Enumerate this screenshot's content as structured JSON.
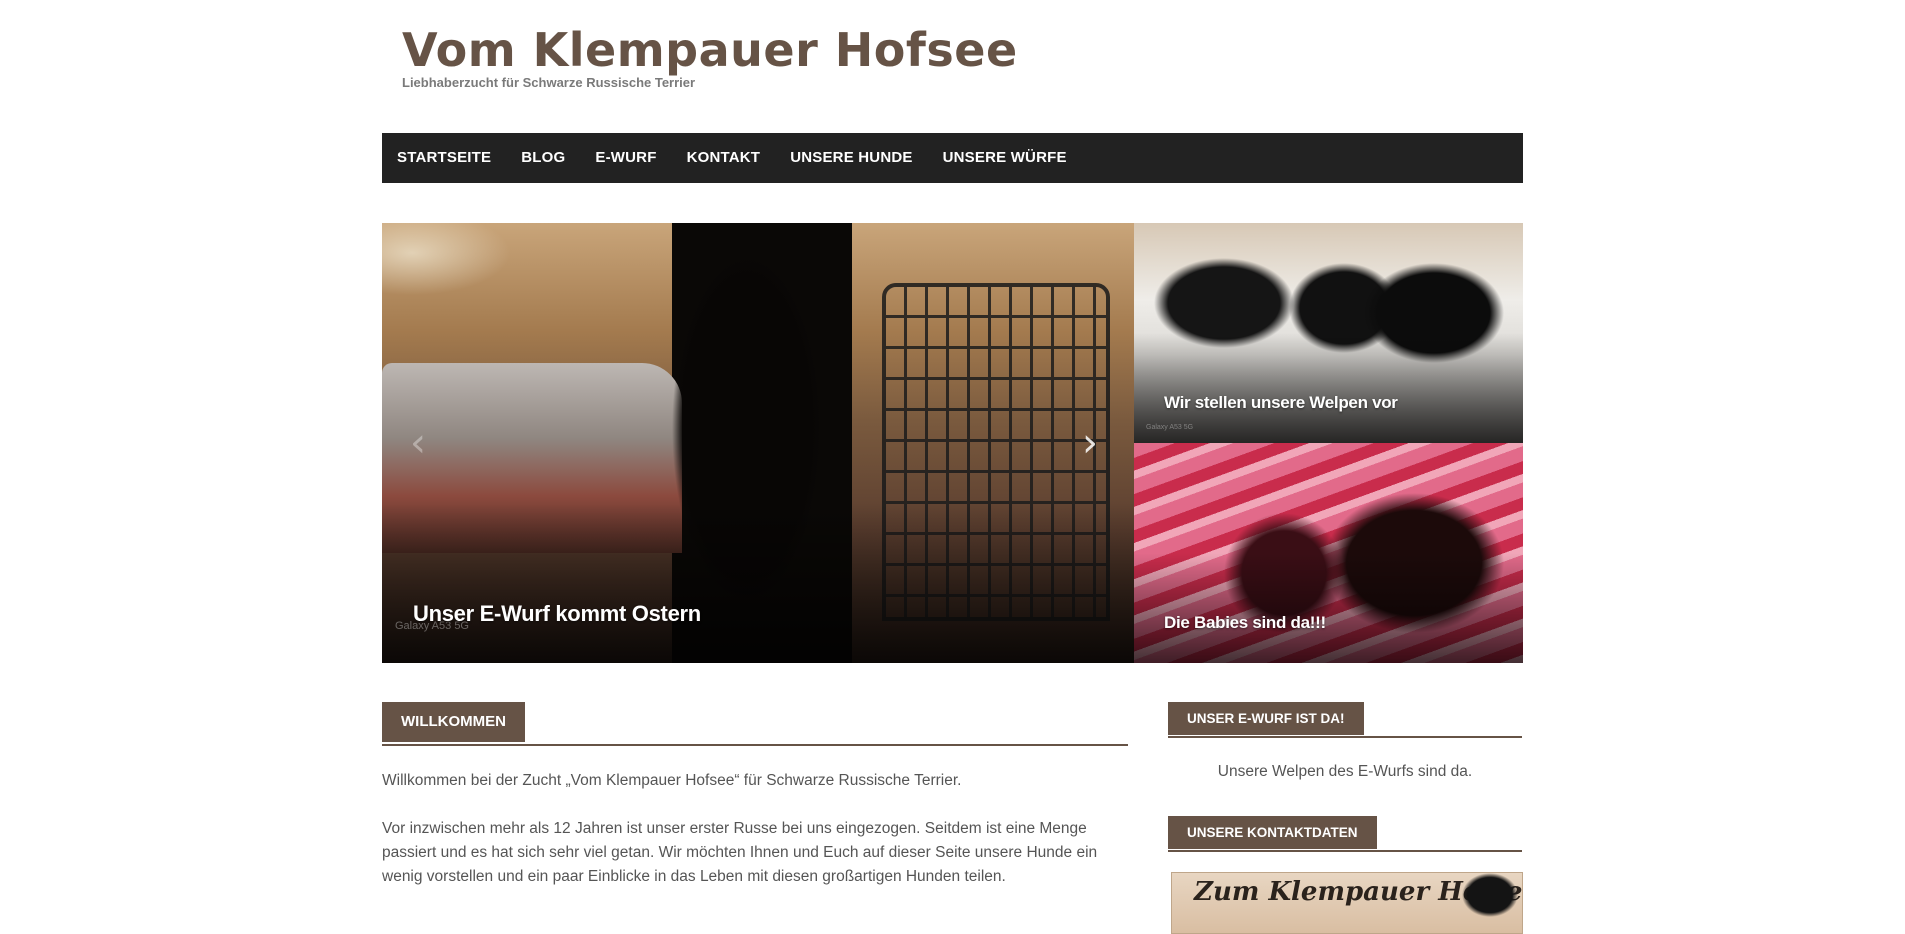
{
  "site": {
    "title": "Vom Klempauer Hofsee",
    "tagline": "Liebhaberzucht für Schwarze Russische Terrier"
  },
  "nav": {
    "items": [
      {
        "label": "STARTSEITE"
      },
      {
        "label": "BLOG"
      },
      {
        "label": "E-WURF"
      },
      {
        "label": "KONTAKT"
      },
      {
        "label": "UNSERE HUNDE"
      },
      {
        "label": "UNSERE WÜRFE"
      }
    ]
  },
  "slider": {
    "main_caption": "Unser E-Wurf kommt Ostern",
    "watermark": "Galaxy A53 5G",
    "prev_icon": "chevron-left-icon",
    "next_icon": "chevron-right-icon",
    "tiles": [
      {
        "caption": "Wir stellen unsere Welpen vor",
        "watermark": "Galaxy A53 5G"
      },
      {
        "caption": "Die Babies sind da!!!"
      }
    ]
  },
  "main": {
    "heading": "WILLKOMMEN",
    "paragraphs": [
      "Willkommen bei der Zucht „Vom Klempauer Hofsee“ für Schwarze Russische Terrier.",
      "Vor inzwischen mehr als 12 Jahren ist unser erster Russe bei uns eingezogen. Seitdem ist eine Menge passiert und es hat sich sehr viel getan. Wir möchten Ihnen und Euch auf dieser Seite unsere Hunde ein wenig vorstellen und ein paar Einblicke in das Leben mit diesen großartigen Hunden teilen."
    ]
  },
  "sidebar": {
    "widgets": [
      {
        "heading": "UNSER E-WURF IST DA!",
        "text": "Unsere Welpen des E-Wurfs sind da."
      },
      {
        "heading": "UNSERE KONTAKTDATEN",
        "banner_text": "Zum Klempauer Hofsee"
      }
    ]
  },
  "colors": {
    "accent": "#665346",
    "nav_bg": "#222222",
    "text": "#555555"
  }
}
